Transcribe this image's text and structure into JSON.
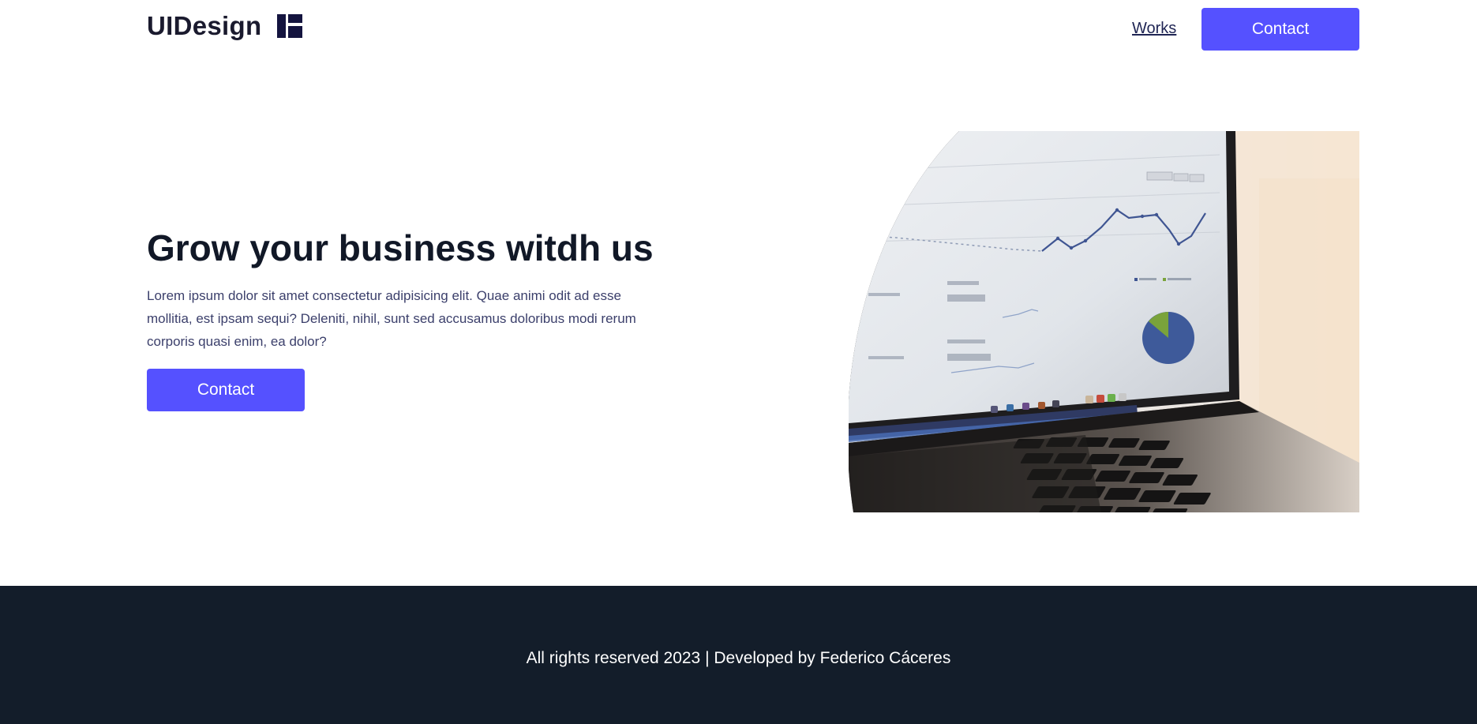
{
  "header": {
    "logo_text": "UIDesign",
    "logo_icon": "layout-grid-icon",
    "nav_works": "Works",
    "contact_label": "Contact"
  },
  "hero": {
    "title": "Grow your business witdh us",
    "description": "Lorem ipsum dolor sit amet consectetur adipisicing elit. Quae animi odit ad esse mollitia, est ipsam sequi? Deleniti, nihil, sunt sed accusamus doloribus modi rerum corporis quasi enim, ea dolor?",
    "contact_label": "Contact",
    "image_alt": "laptop-analytics-dashboard"
  },
  "footer": {
    "text": "All rights reserved 2023 | Developed by Federico Cáceres"
  },
  "colors": {
    "accent": "#5551ff",
    "footer_bg": "#131d2a",
    "heading": "#111827",
    "body_text": "#3b3f6b",
    "logo_icon": "#1a1a4a"
  }
}
